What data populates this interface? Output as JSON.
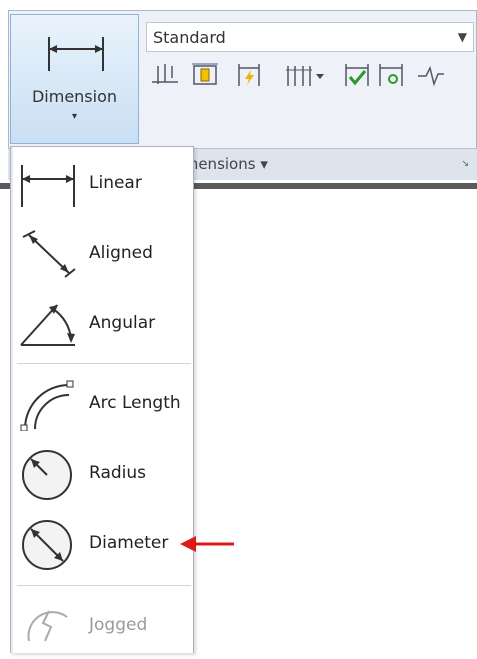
{
  "ribbon": {
    "dimension_button": {
      "label": "Dimension",
      "caret": "▾"
    },
    "style_select": {
      "value": "Standard",
      "arrow": "▼"
    },
    "panel_title": "Dimensions ▾",
    "panel_corner": "↘"
  },
  "menu": {
    "items": [
      {
        "label": "Linear",
        "icon": "linear-dimension-icon"
      },
      {
        "label": "Aligned",
        "icon": "aligned-dimension-icon"
      },
      {
        "label": "Angular",
        "icon": "angular-dimension-icon"
      },
      {
        "label": "Arc Length",
        "icon": "arc-length-icon"
      },
      {
        "label": "Radius",
        "icon": "radius-icon"
      },
      {
        "label": "Diameter",
        "icon": "diameter-icon"
      },
      {
        "label": "Jogged",
        "icon": "jogged-icon",
        "disabled": true
      }
    ]
  },
  "annotation": {
    "color": "#e01818"
  }
}
